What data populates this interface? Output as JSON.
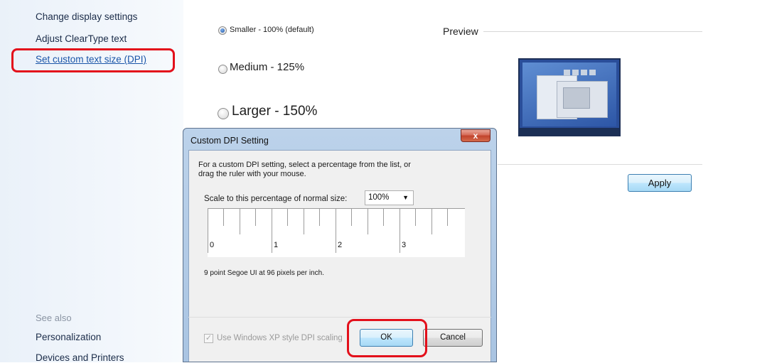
{
  "sidebar": {
    "links": [
      "Change display settings",
      "Adjust ClearType text",
      "Set custom text size (DPI)"
    ],
    "see_also_heading": "See also",
    "see_also_links": [
      "Personalization",
      "Devices and Printers"
    ]
  },
  "main": {
    "options": [
      {
        "label": "Smaller - 100% (default)",
        "checked": true
      },
      {
        "label": "Medium - 125%",
        "checked": false
      },
      {
        "label": "Larger - 150%",
        "checked": false
      }
    ],
    "preview_label": "Preview",
    "apply_label": "Apply"
  },
  "dialog": {
    "title": "Custom DPI Setting",
    "close_label": "x",
    "description_line1": "For a custom DPI setting, select a percentage from the list, or",
    "description_line2": "drag the ruler with your mouse.",
    "scale_label": "Scale to this percentage of normal size:",
    "scale_value": "100%",
    "ruler_labels": [
      "0",
      "1",
      "2",
      "3"
    ],
    "dpi_info": "9 point Segoe UI at 96 pixels per inch.",
    "xp_checkbox_label": "Use Windows XP style DPI scaling",
    "xp_checked": true,
    "ok_label": "OK",
    "cancel_label": "Cancel"
  },
  "colors": {
    "highlight": "#e3101b",
    "link": "#1a55a8"
  }
}
